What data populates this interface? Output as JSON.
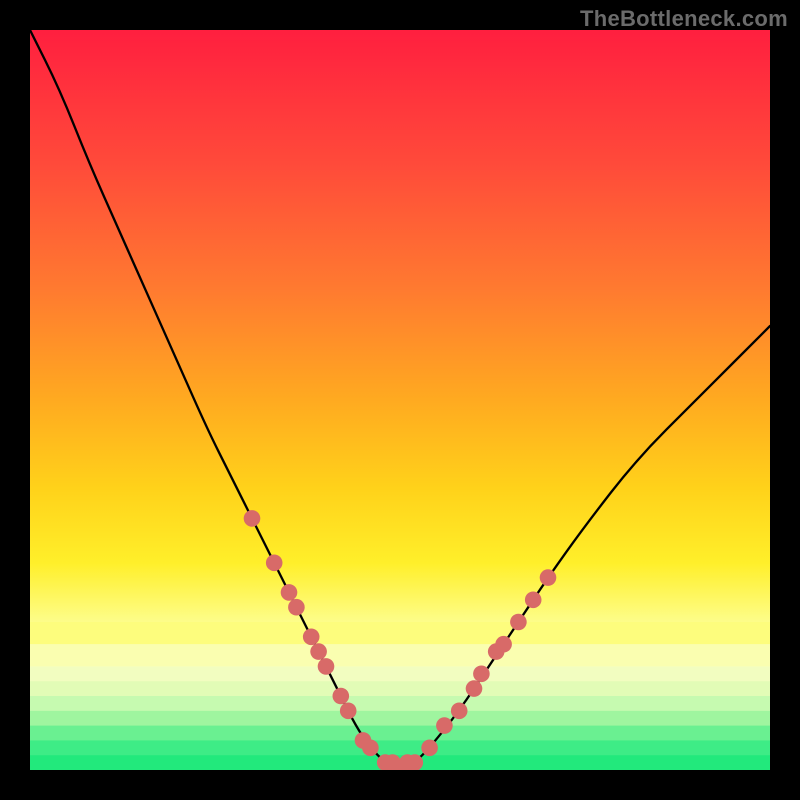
{
  "watermark": "TheBottleneck.com",
  "chart_data": {
    "type": "line",
    "title": "",
    "xlabel": "",
    "ylabel": "",
    "xlim": [
      0,
      100
    ],
    "ylim": [
      0,
      100
    ],
    "grid": false,
    "legend": false,
    "series": [
      {
        "name": "bottleneck-curve",
        "x": [
          0,
          4,
          8,
          12,
          16,
          20,
          24,
          27,
          30,
          33,
          36,
          38,
          40,
          42,
          44,
          46,
          48,
          50,
          52,
          54,
          58,
          62,
          66,
          70,
          75,
          82,
          90,
          100
        ],
        "y": [
          100,
          92,
          82,
          73,
          64,
          55,
          46,
          40,
          34,
          28,
          22,
          18,
          14,
          10,
          6,
          3,
          1,
          0,
          1,
          3,
          8,
          14,
          20,
          26,
          33,
          42,
          50,
          60
        ]
      }
    ],
    "markers": {
      "name": "highlight-dots",
      "color": "#d86a68",
      "points": [
        {
          "x": 30,
          "y": 34
        },
        {
          "x": 33,
          "y": 28
        },
        {
          "x": 35,
          "y": 24
        },
        {
          "x": 36,
          "y": 22
        },
        {
          "x": 38,
          "y": 18
        },
        {
          "x": 39,
          "y": 16
        },
        {
          "x": 40,
          "y": 14
        },
        {
          "x": 42,
          "y": 10
        },
        {
          "x": 43,
          "y": 8
        },
        {
          "x": 45,
          "y": 4
        },
        {
          "x": 46,
          "y": 3
        },
        {
          "x": 48,
          "y": 1
        },
        {
          "x": 49,
          "y": 1
        },
        {
          "x": 50,
          "y": 0
        },
        {
          "x": 51,
          "y": 1
        },
        {
          "x": 52,
          "y": 1
        },
        {
          "x": 54,
          "y": 3
        },
        {
          "x": 56,
          "y": 6
        },
        {
          "x": 58,
          "y": 8
        },
        {
          "x": 60,
          "y": 11
        },
        {
          "x": 61,
          "y": 13
        },
        {
          "x": 63,
          "y": 16
        },
        {
          "x": 64,
          "y": 17
        },
        {
          "x": 66,
          "y": 20
        },
        {
          "x": 68,
          "y": 23
        },
        {
          "x": 70,
          "y": 26
        }
      ]
    },
    "bottom_bands": [
      {
        "y0": 80,
        "y1": 83,
        "color": "#fdfd7d"
      },
      {
        "y0": 83,
        "y1": 86,
        "color": "#fafeb0"
      },
      {
        "y0": 86,
        "y1": 88,
        "color": "#f2fdc0"
      },
      {
        "y0": 88,
        "y1": 90,
        "color": "#e2fcb6"
      },
      {
        "y0": 90,
        "y1": 92,
        "color": "#c6fab0"
      },
      {
        "y0": 92,
        "y1": 94,
        "color": "#9ff59f"
      },
      {
        "y0": 94,
        "y1": 96,
        "color": "#6af091"
      },
      {
        "y0": 96,
        "y1": 98,
        "color": "#3eec86"
      },
      {
        "y0": 98,
        "y1": 100,
        "color": "#22e97c"
      }
    ]
  }
}
